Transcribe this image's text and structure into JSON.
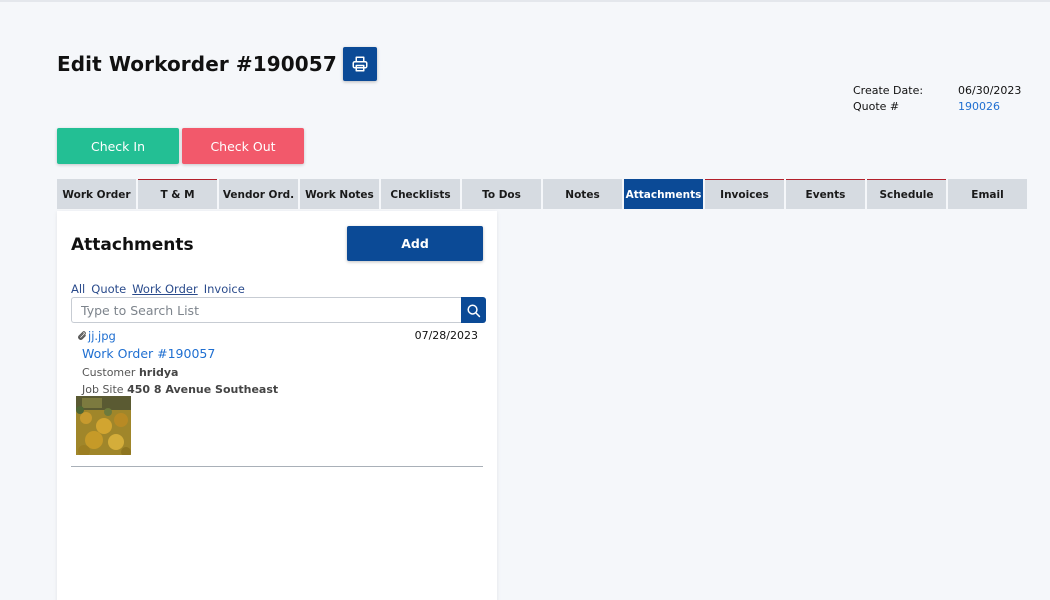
{
  "header": {
    "title": "Edit Workorder #190057",
    "print_icon": "printer-icon"
  },
  "meta": {
    "create_date_label": "Create Date:",
    "create_date_value": "06/30/2023",
    "quote_label": "Quote #",
    "quote_value": "190026"
  },
  "actions": {
    "check_in": "Check In",
    "check_out": "Check Out"
  },
  "colors": {
    "primary": "#0b4a96",
    "check_in": "#23bf94",
    "check_out": "#f2596b",
    "link": "#1f6fd1",
    "tab_bg": "#d6dbe1"
  },
  "tabs": [
    {
      "label": "Work Order"
    },
    {
      "label": "T & M"
    },
    {
      "label": "Vendor Ord."
    },
    {
      "label": "Work Notes"
    },
    {
      "label": "Checklists"
    },
    {
      "label": "To Dos"
    },
    {
      "label": "Notes"
    },
    {
      "label": "Attachments",
      "active": true
    },
    {
      "label": "Invoices"
    },
    {
      "label": "Events"
    },
    {
      "label": "Schedule"
    },
    {
      "label": "Email"
    }
  ],
  "attachments": {
    "title": "Attachments",
    "add_label": "Add",
    "filters": [
      "All",
      "Quote",
      "Work Order",
      "Invoice"
    ],
    "selected_filter": "Work Order",
    "search_placeholder": "Type to Search List",
    "search_icon": "search-icon",
    "items": [
      {
        "file_icon": "paperclip-icon",
        "file_name": "jj.jpg",
        "date": "07/28/2023",
        "work_order": "Work Order #190057",
        "customer_label": "Customer",
        "customer": "hridya",
        "job_site_label": "Job Site",
        "job_site": "450 8 Avenue Southeast"
      }
    ]
  }
}
